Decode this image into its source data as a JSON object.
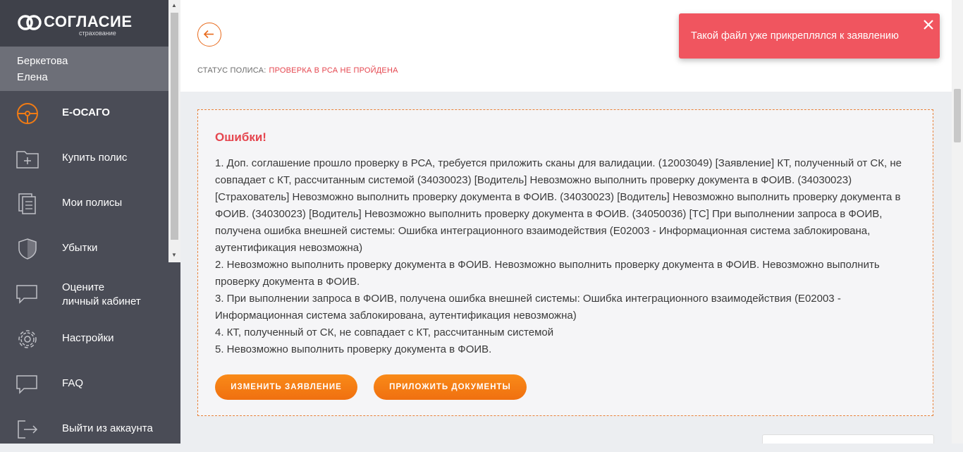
{
  "brand": {
    "name": "СОГЛАСИЕ",
    "sub": "страхование"
  },
  "user": {
    "last_name": "Беркетова",
    "first_name": "Елена"
  },
  "nav": [
    {
      "label": "Е-ОСАГО",
      "icon": "steering-wheel-icon"
    },
    {
      "label": "Купить полис",
      "icon": "folder-plus-icon"
    },
    {
      "label": "Мои полисы",
      "icon": "documents-icon"
    },
    {
      "label": "Убытки",
      "icon": "shield-icon"
    },
    {
      "label_lines": [
        "Оцените",
        "личный кабинет"
      ],
      "icon": "chat-icon"
    },
    {
      "label": "Настройки",
      "icon": "gear-icon"
    },
    {
      "label": "FAQ",
      "icon": "faq-chat-icon"
    },
    {
      "label": "Выйти из аккаунта",
      "icon": "logout-icon"
    }
  ],
  "status": {
    "label": "СТАТУС ПОЛИСА:",
    "value": "ПРОВЕРКА В РСА НЕ ПРОЙДЕНА"
  },
  "errors": {
    "title": "Ошибки!",
    "items": [
      "1. Доп. соглашение прошло проверку в РСА, требуется приложить сканы для валидации. (12003049) [Заявление] КТ, полученный от СК, не совпадает с КТ, рассчитанным системой (34030023) [Водитель] Невозможно выполнить проверку документа в ФОИВ. (34030023) [Страхователь] Невозможно выполнить проверку документа в ФОИВ. (34030023) [Водитель] Невозможно выполнить проверку документа в ФОИВ. (34030023) [Водитель] Невозможно выполнить проверку документа в ФОИВ. (34050036) [ТС] При выполнении запроса в ФОИВ, получена ошибка внешней системы: Ошибка интеграционного взаимодействия (E02003 - Информационная система заблокирована, аутентификация невозможна)",
      "2. Невозможно выполнить проверку документа в ФОИВ. Невозможно выполнить проверку документа в ФОИВ. Невозможно выполнить проверку документа в ФОИВ.",
      "3. При выполнении запроса в ФОИВ, получена ошибка внешней системы: Ошибка интеграционного взаимодействия (E02003 - Информационная система заблокирована, аутентификация невозможна)",
      "4. КТ, полученный от СК, не совпадает с КТ, рассчитанным системой",
      "5. Невозможно выполнить проверку документа в ФОИВ."
    ],
    "actions": {
      "edit": "ИЗМЕНИТЬ ЗАЯВЛЕНИЕ",
      "attach": "ПРИЛОЖИТЬ ДОКУМЕНТЫ"
    }
  },
  "toast": {
    "message": "Такой файл уже прикреплялся к заявлению"
  },
  "colors": {
    "accent": "#f07b14",
    "error": "#e5464f",
    "sidebar": "#4a4c56",
    "toast": "#f0555f"
  }
}
